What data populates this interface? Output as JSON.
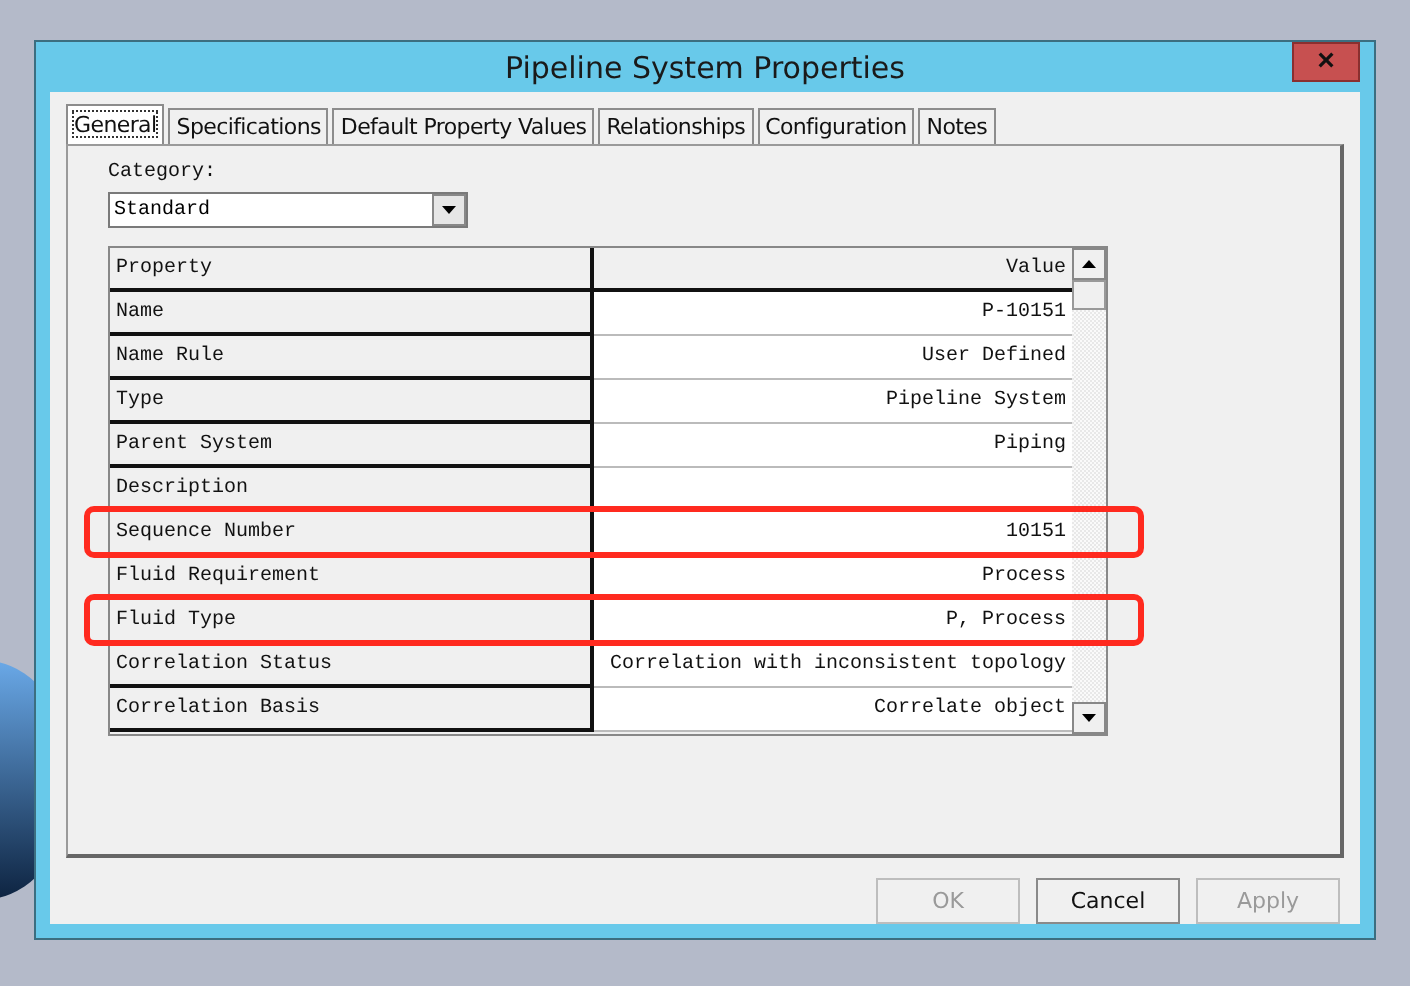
{
  "window": {
    "title": "Pipeline System Properties",
    "close": "×"
  },
  "tabs": [
    {
      "label": "General",
      "selected": true
    },
    {
      "label": "Specifications",
      "selected": false
    },
    {
      "label": "Default Property Values",
      "selected": false
    },
    {
      "label": "Relationships",
      "selected": false
    },
    {
      "label": "Configuration",
      "selected": false
    },
    {
      "label": "Notes",
      "selected": false
    }
  ],
  "category": {
    "label": "Category:",
    "value": "Standard"
  },
  "grid": {
    "columns": [
      "Property",
      "Value"
    ],
    "rows": [
      {
        "property": "Name",
        "value": "P-10151",
        "highlighted": false
      },
      {
        "property": "Name Rule",
        "value": "User Defined",
        "highlighted": false
      },
      {
        "property": "Type",
        "value": "Pipeline System",
        "highlighted": false
      },
      {
        "property": "Parent System",
        "value": "Piping",
        "highlighted": false
      },
      {
        "property": "Description",
        "value": "",
        "highlighted": false
      },
      {
        "property": "Sequence Number",
        "value": "10151",
        "highlighted": true
      },
      {
        "property": "Fluid Requirement",
        "value": "Process",
        "highlighted": false
      },
      {
        "property": "Fluid Type",
        "value": "P, Process",
        "highlighted": true
      },
      {
        "property": "Correlation Status",
        "value": "Correlation with inconsistent topology",
        "highlighted": false
      },
      {
        "property": "Correlation Basis",
        "value": "Correlate object",
        "highlighted": false
      }
    ]
  },
  "buttons": [
    {
      "label": "OK",
      "disabled": true
    },
    {
      "label": "Cancel",
      "disabled": false
    },
    {
      "label": "Apply",
      "disabled": true
    }
  ]
}
